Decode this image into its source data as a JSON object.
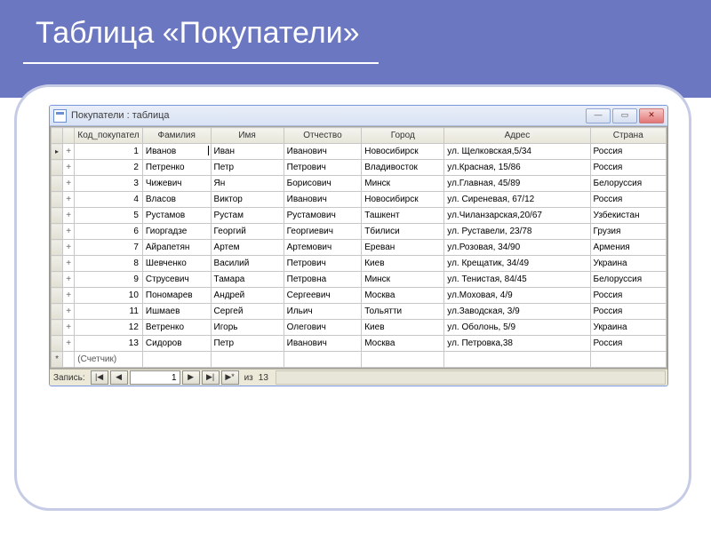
{
  "slide": {
    "title": "Таблица «Покупатели»"
  },
  "window": {
    "title": "Покупатели : таблица",
    "min_label": "—",
    "max_label": "▭",
    "close_label": "✕"
  },
  "grid": {
    "columns": [
      "Код_покупател",
      "Фамилия",
      "Имя",
      "Отчество",
      "Город",
      "Адрес",
      "Страна"
    ],
    "new_row_marker": "*",
    "placeholder_id": "(Счетчик)",
    "expand_marker": "+",
    "rows": [
      {
        "id": 1,
        "familia": "Иванов",
        "imya": "Иван",
        "otch": "Иванович",
        "gorod": "Новосибирск",
        "adres": "ул. Щелковская,5/34",
        "strana": "Россия"
      },
      {
        "id": 2,
        "familia": "Петренко",
        "imya": "Петр",
        "otch": "Петрович",
        "gorod": "Владивосток",
        "adres": "ул.Красная, 15/86",
        "strana": "Россия"
      },
      {
        "id": 3,
        "familia": "Чижевич",
        "imya": "Ян",
        "otch": "Борисович",
        "gorod": "Минск",
        "adres": "ул.Главная, 45/89",
        "strana": "Белоруссия"
      },
      {
        "id": 4,
        "familia": "Власов",
        "imya": "Виктор",
        "otch": "Иванович",
        "gorod": "Новосибирск",
        "adres": "ул. Сиреневая, 67/12",
        "strana": "Россия"
      },
      {
        "id": 5,
        "familia": "Рустамов",
        "imya": "Рустам",
        "otch": "Рустамович",
        "gorod": "Ташкент",
        "adres": "ул.Чиланзарская,20/67",
        "strana": "Узбекистан"
      },
      {
        "id": 6,
        "familia": "Гиоргадзе",
        "imya": "Георгий",
        "otch": "Георгиевич",
        "gorod": "Тбилиси",
        "adres": "ул. Руставели, 23/78",
        "strana": "Грузия"
      },
      {
        "id": 7,
        "familia": "Айрапетян",
        "imya": "Артем",
        "otch": "Артемович",
        "gorod": "Ереван",
        "adres": "ул.Розовая, 34/90",
        "strana": "Армения"
      },
      {
        "id": 8,
        "familia": "Шевченко",
        "imya": "Василий",
        "otch": "Петрович",
        "gorod": "Киев",
        "adres": "ул. Крещатик, 34/49",
        "strana": "Украина"
      },
      {
        "id": 9,
        "familia": "Струсевич",
        "imya": "Тамара",
        "otch": "Петровна",
        "gorod": "Минск",
        "adres": "ул. Тенистая, 84/45",
        "strana": "Белоруссия"
      },
      {
        "id": 10,
        "familia": "Пономарев",
        "imya": "Андрей",
        "otch": "Сергеевич",
        "gorod": "Москва",
        "adres": "ул.Моховая, 4/9",
        "strana": "Россия"
      },
      {
        "id": 11,
        "familia": "Ишмаев",
        "imya": "Сергей",
        "otch": "Ильич",
        "gorod": "Тольятти",
        "adres": "ул.Заводская, 3/9",
        "strana": "Россия"
      },
      {
        "id": 12,
        "familia": "Ветренко",
        "imya": "Игорь",
        "otch": "Олегович",
        "gorod": "Киев",
        "adres": "ул. Оболонь, 5/9",
        "strana": "Украина"
      },
      {
        "id": 13,
        "familia": "Сидоров",
        "imya": "Петр",
        "otch": "Иванович",
        "gorod": "Москва",
        "adres": "ул. Петровка,38",
        "strana": "Россия"
      }
    ]
  },
  "nav": {
    "label": "Запись:",
    "first": "|◀",
    "prev": "◀",
    "current": "1",
    "next": "▶",
    "last": "▶|",
    "new": "▶*",
    "of_label": "из",
    "total": "13"
  }
}
